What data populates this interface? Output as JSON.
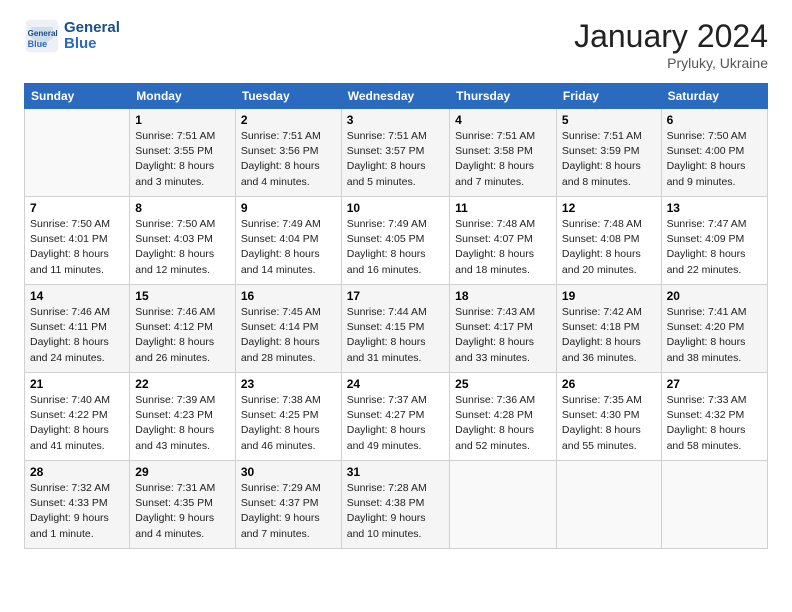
{
  "logo": {
    "line1": "General",
    "line2": "Blue"
  },
  "title": "January 2024",
  "subtitle": "Pryluky, Ukraine",
  "days_header": [
    "Sunday",
    "Monday",
    "Tuesday",
    "Wednesday",
    "Thursday",
    "Friday",
    "Saturday"
  ],
  "weeks": [
    [
      {
        "num": "",
        "info": ""
      },
      {
        "num": "1",
        "info": "Sunrise: 7:51 AM\nSunset: 3:55 PM\nDaylight: 8 hours\nand 3 minutes."
      },
      {
        "num": "2",
        "info": "Sunrise: 7:51 AM\nSunset: 3:56 PM\nDaylight: 8 hours\nand 4 minutes."
      },
      {
        "num": "3",
        "info": "Sunrise: 7:51 AM\nSunset: 3:57 PM\nDaylight: 8 hours\nand 5 minutes."
      },
      {
        "num": "4",
        "info": "Sunrise: 7:51 AM\nSunset: 3:58 PM\nDaylight: 8 hours\nand 7 minutes."
      },
      {
        "num": "5",
        "info": "Sunrise: 7:51 AM\nSunset: 3:59 PM\nDaylight: 8 hours\nand 8 minutes."
      },
      {
        "num": "6",
        "info": "Sunrise: 7:50 AM\nSunset: 4:00 PM\nDaylight: 8 hours\nand 9 minutes."
      }
    ],
    [
      {
        "num": "7",
        "info": "Sunrise: 7:50 AM\nSunset: 4:01 PM\nDaylight: 8 hours\nand 11 minutes."
      },
      {
        "num": "8",
        "info": "Sunrise: 7:50 AM\nSunset: 4:03 PM\nDaylight: 8 hours\nand 12 minutes."
      },
      {
        "num": "9",
        "info": "Sunrise: 7:49 AM\nSunset: 4:04 PM\nDaylight: 8 hours\nand 14 minutes."
      },
      {
        "num": "10",
        "info": "Sunrise: 7:49 AM\nSunset: 4:05 PM\nDaylight: 8 hours\nand 16 minutes."
      },
      {
        "num": "11",
        "info": "Sunrise: 7:48 AM\nSunset: 4:07 PM\nDaylight: 8 hours\nand 18 minutes."
      },
      {
        "num": "12",
        "info": "Sunrise: 7:48 AM\nSunset: 4:08 PM\nDaylight: 8 hours\nand 20 minutes."
      },
      {
        "num": "13",
        "info": "Sunrise: 7:47 AM\nSunset: 4:09 PM\nDaylight: 8 hours\nand 22 minutes."
      }
    ],
    [
      {
        "num": "14",
        "info": "Sunrise: 7:46 AM\nSunset: 4:11 PM\nDaylight: 8 hours\nand 24 minutes."
      },
      {
        "num": "15",
        "info": "Sunrise: 7:46 AM\nSunset: 4:12 PM\nDaylight: 8 hours\nand 26 minutes."
      },
      {
        "num": "16",
        "info": "Sunrise: 7:45 AM\nSunset: 4:14 PM\nDaylight: 8 hours\nand 28 minutes."
      },
      {
        "num": "17",
        "info": "Sunrise: 7:44 AM\nSunset: 4:15 PM\nDaylight: 8 hours\nand 31 minutes."
      },
      {
        "num": "18",
        "info": "Sunrise: 7:43 AM\nSunset: 4:17 PM\nDaylight: 8 hours\nand 33 minutes."
      },
      {
        "num": "19",
        "info": "Sunrise: 7:42 AM\nSunset: 4:18 PM\nDaylight: 8 hours\nand 36 minutes."
      },
      {
        "num": "20",
        "info": "Sunrise: 7:41 AM\nSunset: 4:20 PM\nDaylight: 8 hours\nand 38 minutes."
      }
    ],
    [
      {
        "num": "21",
        "info": "Sunrise: 7:40 AM\nSunset: 4:22 PM\nDaylight: 8 hours\nand 41 minutes."
      },
      {
        "num": "22",
        "info": "Sunrise: 7:39 AM\nSunset: 4:23 PM\nDaylight: 8 hours\nand 43 minutes."
      },
      {
        "num": "23",
        "info": "Sunrise: 7:38 AM\nSunset: 4:25 PM\nDaylight: 8 hours\nand 46 minutes."
      },
      {
        "num": "24",
        "info": "Sunrise: 7:37 AM\nSunset: 4:27 PM\nDaylight: 8 hours\nand 49 minutes."
      },
      {
        "num": "25",
        "info": "Sunrise: 7:36 AM\nSunset: 4:28 PM\nDaylight: 8 hours\nand 52 minutes."
      },
      {
        "num": "26",
        "info": "Sunrise: 7:35 AM\nSunset: 4:30 PM\nDaylight: 8 hours\nand 55 minutes."
      },
      {
        "num": "27",
        "info": "Sunrise: 7:33 AM\nSunset: 4:32 PM\nDaylight: 8 hours\nand 58 minutes."
      }
    ],
    [
      {
        "num": "28",
        "info": "Sunrise: 7:32 AM\nSunset: 4:33 PM\nDaylight: 9 hours\nand 1 minute."
      },
      {
        "num": "29",
        "info": "Sunrise: 7:31 AM\nSunset: 4:35 PM\nDaylight: 9 hours\nand 4 minutes."
      },
      {
        "num": "30",
        "info": "Sunrise: 7:29 AM\nSunset: 4:37 PM\nDaylight: 9 hours\nand 7 minutes."
      },
      {
        "num": "31",
        "info": "Sunrise: 7:28 AM\nSunset: 4:38 PM\nDaylight: 9 hours\nand 10 minutes."
      },
      {
        "num": "",
        "info": ""
      },
      {
        "num": "",
        "info": ""
      },
      {
        "num": "",
        "info": ""
      }
    ]
  ]
}
